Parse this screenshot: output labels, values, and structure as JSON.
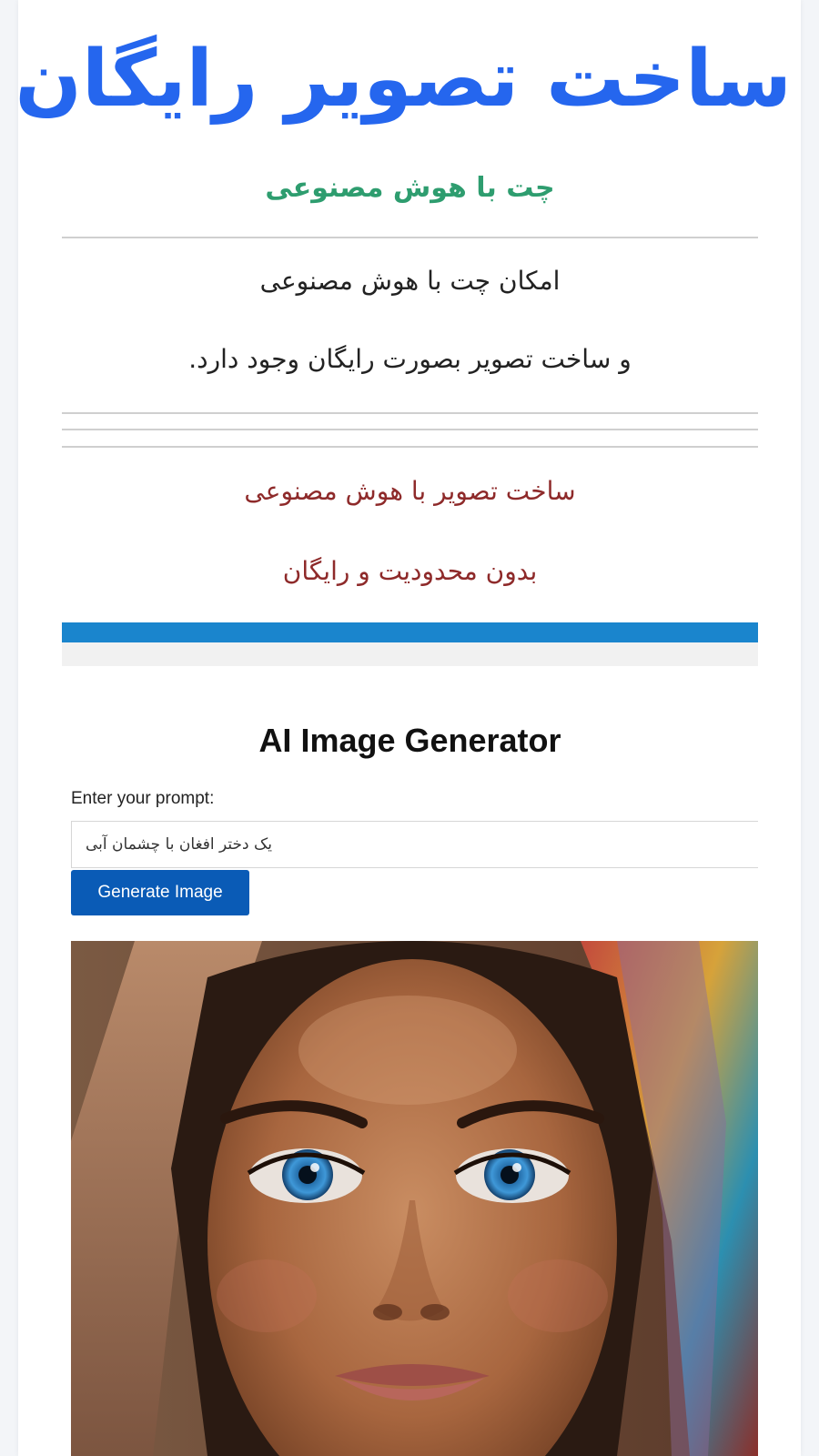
{
  "hero": {
    "title": "ساخت تصویر رایگان"
  },
  "intro": {
    "heading": "چت با هوش مصنوعی",
    "line1": "امکان چت با هوش مصنوعی",
    "line2": "و ساخت تصویر بصورت رایگان وجود دارد."
  },
  "promo": {
    "line1": "ساخت تصویر با هوش مصنوعی",
    "line2": "بدون محدودیت و رایگان"
  },
  "generator": {
    "title": "AI Image Generator",
    "prompt_label": "Enter your prompt:",
    "prompt_value": "یک دختر افغان با چشمان آبی",
    "button_label": "Generate Image"
  },
  "colors": {
    "hero_title": "#2566ee",
    "green_heading": "#2e9d6f",
    "red_text": "#8e2a2a",
    "blue_bar": "#1a85cd",
    "button": "#0a5bb6"
  }
}
